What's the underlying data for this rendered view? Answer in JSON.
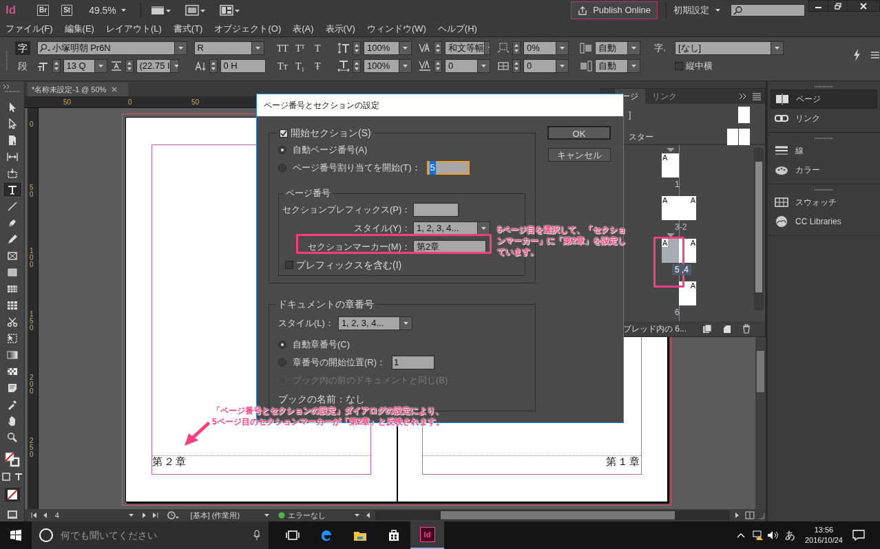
{
  "app_bar": {
    "logo": "Id",
    "bridge": "Br",
    "stock": "St",
    "zoom": "49.5%",
    "publish": "Publish Online",
    "workspace": "初期設定"
  },
  "menu": [
    "ファイル(F)",
    "編集(E)",
    "レイアウト(L)",
    "書式(T)",
    "オブジェクト(O)",
    "表(A)",
    "表示(V)",
    "ウィンドウ(W)",
    "ヘルプ(H)"
  ],
  "control_panel": {
    "modes": [
      {
        "label": "字",
        "selected": true
      },
      {
        "label": "段",
        "selected": false
      }
    ],
    "font": "小塚明朝 Pr6N",
    "font_style": "R",
    "size": "13 Q",
    "leading": "(22.75 I",
    "baseline_shift": "0 H",
    "case_buttons": [
      "TT",
      "Tᵀ",
      "T",
      "Tᴛ",
      "T₁",
      "Ŧ"
    ],
    "vertical_scale": "100%",
    "horizontal_scale": "100%",
    "kerning": "和文等幅",
    "tracking": "0",
    "tsume": "0%",
    "aki": "0",
    "aki_before": "自動",
    "aki_after": "自動",
    "char_style_label": "字.",
    "char_style": "[なし]",
    "tatechuyoko": {
      "label": "縦中横",
      "checked": false
    }
  },
  "tools": [
    {
      "kind": "selection",
      "selected": false
    },
    {
      "kind": "direct",
      "selected": false
    },
    {
      "kind": "page",
      "selected": false
    },
    {
      "kind": "gap",
      "selected": false
    },
    {
      "kind": "content",
      "selected": false
    },
    {
      "kind": "type",
      "selected": true
    },
    {
      "kind": "line",
      "selected": false
    },
    {
      "kind": "pen",
      "selected": false
    },
    {
      "kind": "pencil",
      "selected": false
    },
    {
      "kind": "frame",
      "selected": false
    },
    {
      "kind": "rect",
      "selected": false
    },
    {
      "kind": "table",
      "selected": false
    },
    {
      "kind": "grid",
      "selected": false
    },
    {
      "kind": "scissors",
      "selected": false
    },
    {
      "kind": "transform",
      "selected": false
    },
    {
      "kind": "gradient",
      "selected": false
    },
    {
      "kind": "feather",
      "selected": false
    },
    {
      "kind": "note",
      "selected": false
    },
    {
      "kind": "eyedropper",
      "selected": false
    },
    {
      "kind": "hand",
      "selected": false
    },
    {
      "kind": "zoom",
      "selected": false
    }
  ],
  "document": {
    "tab": "*名称未設定-1 @ 50%",
    "ruler_h": [
      "50",
      "0",
      "50"
    ],
    "ruler_v": [
      "0",
      "50",
      "100",
      "150",
      "200",
      "250"
    ],
    "left_marker": "第２章",
    "right_marker": "第１章"
  },
  "dialog": {
    "title": "ページ番号とセクションの設定",
    "ok": "OK",
    "cancel": "キャンセル",
    "start_section": {
      "label": "開始セクション(S)",
      "checked": true
    },
    "page_radios": [
      {
        "label": "自動ページ番号(A)",
        "selected": true,
        "disabled": false
      },
      {
        "label": "ページ番号割り当てを開始(T)：",
        "selected": false,
        "disabled": false,
        "value": "5",
        "focused": true
      }
    ],
    "page_group": {
      "title": "ページ番号",
      "prefix_label": "セクションプレフィックス(P)：",
      "style_label": "スタイル(Y)：",
      "style": "1, 2, 3, 4...",
      "marker_label": "セクションマーカー(M)：",
      "marker": "第2章",
      "include_prefix": {
        "label": "プレフィックスを含む(I)",
        "checked": false
      }
    },
    "chapter_group": {
      "title": "ドキュメントの章番号",
      "style_label": "スタイル(L)：",
      "style": "1, 2, 3, 4...",
      "radios": [
        {
          "label": "自動章番号(C)",
          "selected": true,
          "disabled": false
        },
        {
          "label": "章番号の開始位置(R)：",
          "selected": false,
          "disabled": false,
          "value": "1",
          "focused": false
        },
        {
          "label": "ブック内の前のドキュメントと同じ(B)",
          "selected": false,
          "disabled": true
        }
      ],
      "book_name": "ブックの名前：なし"
    }
  },
  "pages_panel": {
    "tabs": [
      {
        "label": "ージ",
        "selected": true
      },
      {
        "label": "リンク",
        "selected": false
      }
    ],
    "masters": [
      "]",
      "スター"
    ],
    "spreads": [
      {
        "label": "1",
        "selected": false,
        "section_start": true,
        "left_page": {
          "master": "A",
          "selected": false
        }
      },
      {
        "label": "3-2",
        "selected": false,
        "section_start": false,
        "left_page": {
          "master": "A",
          "selected": false
        },
        "right_page": {
          "master": "A",
          "selected": false
        }
      },
      {
        "label": "5 ,4",
        "selected": true,
        "section_start": true,
        "left_page": {
          "master": "A",
          "selected": true
        },
        "right_page": {
          "master": "A",
          "selected": false
        }
      },
      {
        "label": "6",
        "selected": false,
        "section_start": false,
        "right_page": {
          "master": "A",
          "selected": false
        }
      }
    ],
    "footer": "プレッド内の 6..."
  },
  "dock": [
    [
      {
        "kind": "pages",
        "label": "ページ",
        "selected": true
      },
      {
        "kind": "links",
        "label": "リンク",
        "selected": false
      }
    ],
    [
      {
        "kind": "stroke",
        "label": "線",
        "selected": false
      },
      {
        "kind": "color",
        "label": "カラー",
        "selected": false
      }
    ],
    [
      {
        "kind": "swatches",
        "label": "スウォッチ",
        "selected": false
      },
      {
        "kind": "libraries",
        "label": "CC Libraries",
        "selected": false
      }
    ]
  ],
  "annotations": [
    {
      "text": "5ページ目を選択して、「セクションマーカー」に「第2章」を設定しています。"
    },
    {
      "text": "「ページ番号とセクションの設定」ダイアログの設定により、5ページ目のセクションマーカーが「第2章」と反映されます。"
    }
  ],
  "status_bar": {
    "page": "4",
    "profile": "[基本] (作業用)",
    "preflight": "エラーなし"
  },
  "taskbar": {
    "search_placeholder": "何でも聞いてください",
    "apps": [
      {
        "kind": "taskview",
        "selected": false
      },
      {
        "kind": "edge",
        "selected": false
      },
      {
        "kind": "explorer",
        "selected": false
      },
      {
        "kind": "store",
        "selected": false
      },
      {
        "kind": "indesign",
        "label": "Id",
        "selected": true
      }
    ],
    "ime": "あ",
    "time": "13:56",
    "date": "2016/10/24"
  }
}
